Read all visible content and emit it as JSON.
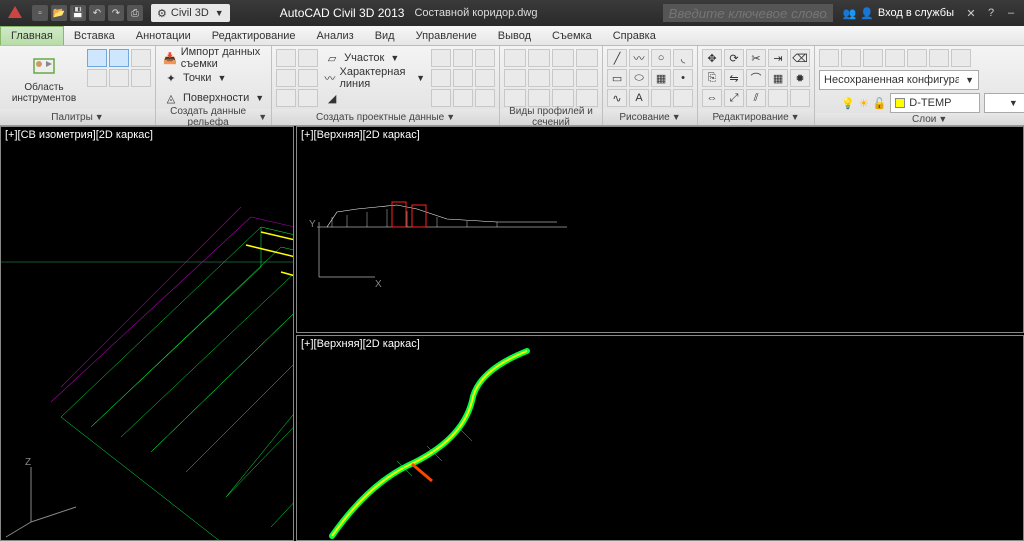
{
  "titlebar": {
    "workspace": "Civil 3D",
    "apptitle": "AutoCAD Civil 3D 2013",
    "filename": "Составной коридор.dwg",
    "search_placeholder": "Введите ключевое слово/фразу",
    "signin": "Вход в службы"
  },
  "menubar": {
    "tabs": [
      "Главная",
      "Вставка",
      "Аннотации",
      "Редактирование",
      "Анализ",
      "Вид",
      "Управление",
      "Вывод",
      "Съемка",
      "Справка"
    ],
    "active": 0
  },
  "ribbon": {
    "panels": [
      {
        "title": "Палитры",
        "big": {
          "label": "Область инструментов"
        }
      },
      {
        "title": "Создать данные рельефа",
        "items": [
          "Импорт данных съемки",
          "Точки",
          "Поверхности"
        ]
      },
      {
        "title": "Создать проектные данные",
        "items": [
          "Участок",
          "Характерная линия"
        ]
      },
      {
        "title": "Виды профилей и сечений"
      },
      {
        "title": "Рисование"
      },
      {
        "title": "Редактирование"
      },
      {
        "title": "Слои",
        "combo1": "Несохраненная конфигурация сло",
        "combo2": "D-TEMP"
      }
    ]
  },
  "viewports": {
    "top_left": "[+][Верхняя][2D каркас]",
    "bottom_left": "[+][Верхняя][2D каркас]",
    "right": "[+][СВ изометрия][2D каркас]"
  }
}
